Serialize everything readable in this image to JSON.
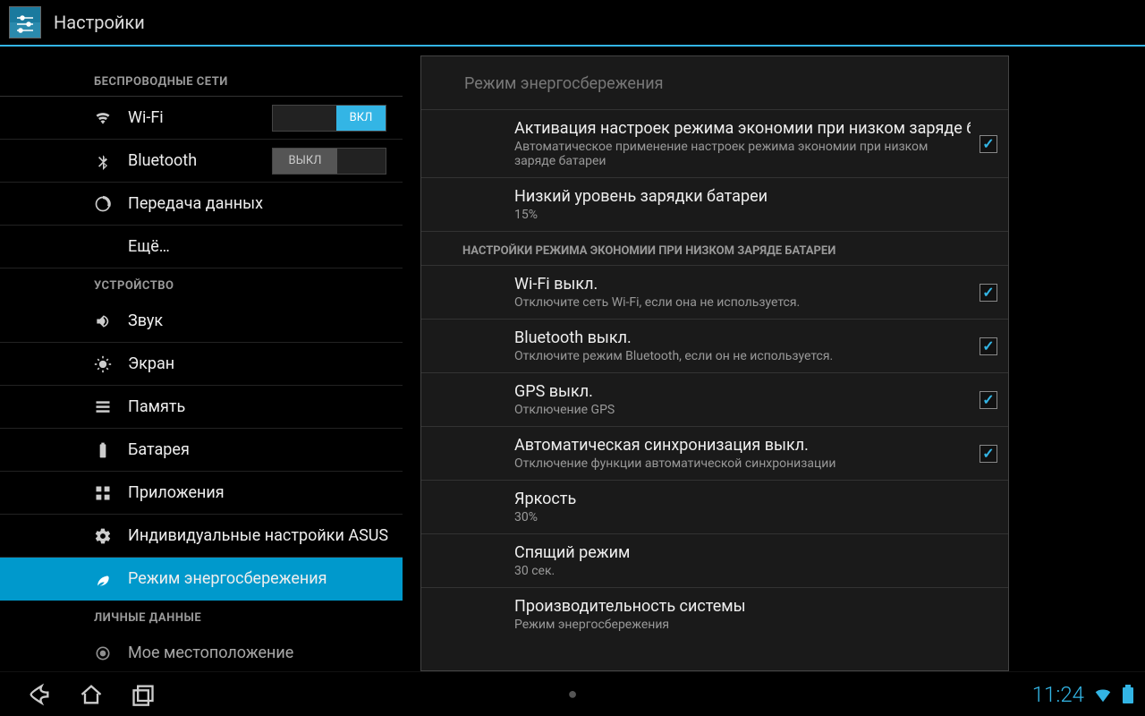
{
  "header": {
    "title": "Настройки"
  },
  "sidebar": {
    "cat_wireless": "БЕСПРОВОДНЫЕ СЕТИ",
    "cat_device": "УСТРОЙСТВО",
    "cat_personal": "ЛИЧНЫЕ ДАННЫЕ",
    "wifi": "Wi-Fi",
    "bluetooth": "Bluetooth",
    "data": "Передача данных",
    "more": "Ещё…",
    "sound": "Звук",
    "display": "Экран",
    "storage": "Память",
    "battery": "Батарея",
    "apps": "Приложения",
    "asus": "Индивидуальные настройки ASUS",
    "power": "Режим энергосбережения",
    "location": "Мое местоположение",
    "toggle_on": "ВКЛ",
    "toggle_off": "ВЫКЛ"
  },
  "content": {
    "title": "Режим энергосбережения",
    "activation_t": "Активация настроек режима экономии при низком заряде батареи",
    "activation_s": "Автоматическое применение настроек режима экономии при низком заряде батареи",
    "low_t": "Низкий уровень зарядки батареи",
    "low_s": "15%",
    "section": "НАСТРОЙКИ РЕЖИМА ЭКОНОМИИ ПРИ НИЗКОМ ЗАРЯДЕ БАТАРЕИ",
    "wifi_t": "Wi-Fi выкл.",
    "wifi_s": "Отключите сеть Wi-Fi, если она не используется.",
    "bt_t": "Bluetooth выкл.",
    "bt_s": "Отключите режим Bluetooth, если он не используется.",
    "gps_t": "GPS выкл.",
    "gps_s": "Отключение GPS",
    "sync_t": "Автоматическая синхронизация выкл.",
    "sync_s": "Отключение функции автоматической синхронизации",
    "bright_t": "Яркость",
    "bright_s": "30%",
    "sleep_t": "Спящий режим",
    "sleep_s": "30 сек.",
    "perf_t": "Производительность системы",
    "perf_s": "Режим энергосбережения"
  },
  "navbar": {
    "time": "11:24"
  }
}
